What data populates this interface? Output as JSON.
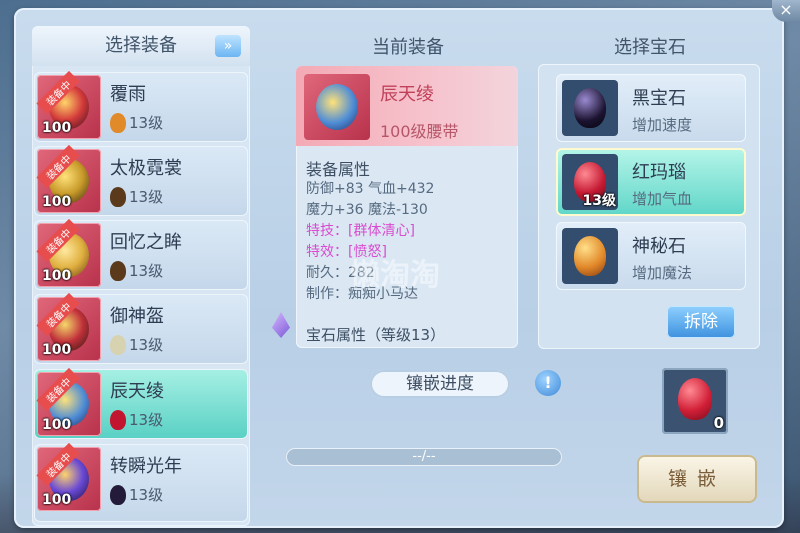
{
  "columns": {
    "select_equipment": "选择装备",
    "current_equipment": "当前装备",
    "select_gem": "选择宝石"
  },
  "equipment_list": [
    {
      "name": "覆雨",
      "level": "100",
      "tag": "装备中",
      "gem_level": "13级",
      "gem_color": "#e08a2a"
    },
    {
      "name": "太极霓裳",
      "level": "100",
      "tag": "装备中",
      "gem_level": "13级",
      "gem_color": "#5a3a1a"
    },
    {
      "name": "回忆之眸",
      "level": "100",
      "tag": "装备中",
      "gem_level": "13级",
      "gem_color": "#5a3a1a"
    },
    {
      "name": "御神盔",
      "level": "100",
      "tag": "装备中",
      "gem_level": "13级",
      "gem_color": "#d7d3b0"
    },
    {
      "name": "辰天绫",
      "level": "100",
      "tag": "装备中",
      "gem_level": "13级",
      "gem_color": "#c21530"
    },
    {
      "name": "转瞬光年",
      "level": "100",
      "tag": "装备中",
      "gem_level": "13级",
      "gem_color": "#241a3a"
    }
  ],
  "current": {
    "name": "辰天绫",
    "type": "100级腰带",
    "attr_title": "装备属性",
    "lines": [
      "防御+83 气血+432",
      "魔力+36 魔法-130",
      "特技：[群体清心]",
      "特效：[愤怒]",
      "耐久：282",
      "制作：痴痴小马达"
    ],
    "gem_attr": "宝石属性（等级13）"
  },
  "watermark": "懒淘淘",
  "inlay_progress_label": "镶嵌进度",
  "help_icon": "!",
  "progress": {
    "text": "--/--",
    "fraction": 0.0
  },
  "gems": [
    {
      "name": "黑宝石",
      "desc": "增加速度",
      "level": "",
      "color": "#1b1330"
    },
    {
      "name": "红玛瑙",
      "desc": "增加气血",
      "level": "13级",
      "color": "#c51a33"
    },
    {
      "name": "神秘石",
      "desc": "增加魔法",
      "level": "",
      "color": "#e2892a"
    }
  ],
  "remove_label": "拆除",
  "slot_count": "0",
  "inlay_button": "镶嵌",
  "close_icon": "×"
}
